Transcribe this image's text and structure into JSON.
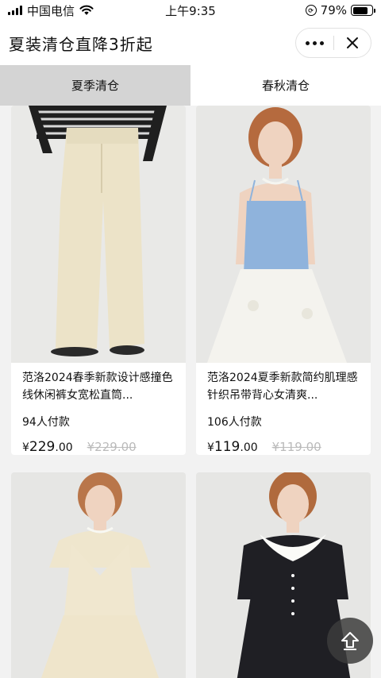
{
  "status_bar": {
    "carrier": "中国电信",
    "time": "上午9:35",
    "battery_percent": "79%",
    "battery_level": 0.79
  },
  "header": {
    "title": "夏装清仓直降3折起",
    "more_icon": "more-dots-icon",
    "close_icon": "close-icon"
  },
  "tabs": [
    {
      "label": "夏季清仓",
      "active": true
    },
    {
      "label": "春秋清仓",
      "active": false
    }
  ],
  "products": [
    {
      "name": "范洛2024春季新款设计感撞色线休闲裤女宽松直筒...",
      "sold": "94人付款",
      "price_symbol": "¥",
      "price_int": "229",
      "price_dec": ".00",
      "original_price": "¥229.00"
    },
    {
      "name": "范洛2024夏季新款简约肌理感针织吊带背心女清爽...",
      "sold": "106人付款",
      "price_symbol": "¥",
      "price_int": "119",
      "price_dec": ".00",
      "original_price": "¥119.00"
    }
  ],
  "back_to_top_icon": "back-to-top-icon",
  "colors": {
    "tab_active_bg": "#d4d4d4",
    "page_bg": "#f2f2f2",
    "strike_price": "#bbbbbb"
  }
}
